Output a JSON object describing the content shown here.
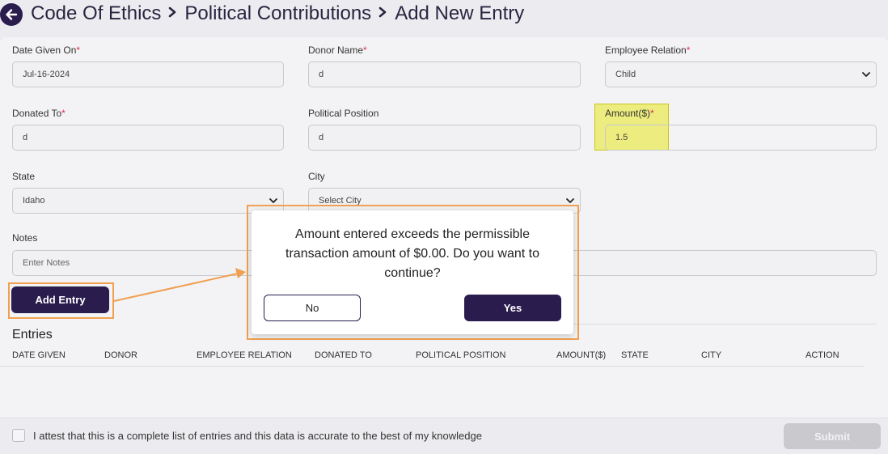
{
  "header": {
    "crumbs": [
      "Code Of Ethics",
      "Political Contributions",
      "Add New Entry"
    ]
  },
  "form": {
    "date_given": {
      "label": "Date Given On",
      "value": "Jul-16-2024"
    },
    "donor_name": {
      "label": "Donor Name",
      "value": "d"
    },
    "employee_relation": {
      "label": "Employee Relation",
      "value": "Child"
    },
    "donated_to": {
      "label": "Donated To",
      "value": "d"
    },
    "political_position": {
      "label": "Political Position",
      "value": "d"
    },
    "amount": {
      "label": "Amount($)",
      "value": "1.5"
    },
    "state": {
      "label": "State",
      "value": "Idaho"
    },
    "city": {
      "label": "City",
      "value": "Select City"
    },
    "notes": {
      "label": "Notes",
      "placeholder": "Enter Notes"
    },
    "required_mark": "*"
  },
  "add_entry_label": "Add Entry",
  "entries": {
    "title": "Entries",
    "columns": [
      "DATE GIVEN",
      "DONOR",
      "EMPLOYEE RELATION",
      "DONATED TO",
      "POLITICAL POSITION",
      "AMOUNT($)",
      "STATE",
      "CITY",
      "ACTION"
    ]
  },
  "modal": {
    "message": "Amount entered exceeds the permissible transaction amount of $0.00. Do you want to continue?",
    "no_label": "No",
    "yes_label": "Yes"
  },
  "footer": {
    "attest_text": "I attest that this is a complete list of entries and this data is accurate to the best of my knowledge",
    "submit_label": "Submit"
  },
  "colors": {
    "primary": "#2a1d4e",
    "annotation": "#f0a050",
    "highlight": "#e6e61e",
    "required": "#e0304a"
  }
}
